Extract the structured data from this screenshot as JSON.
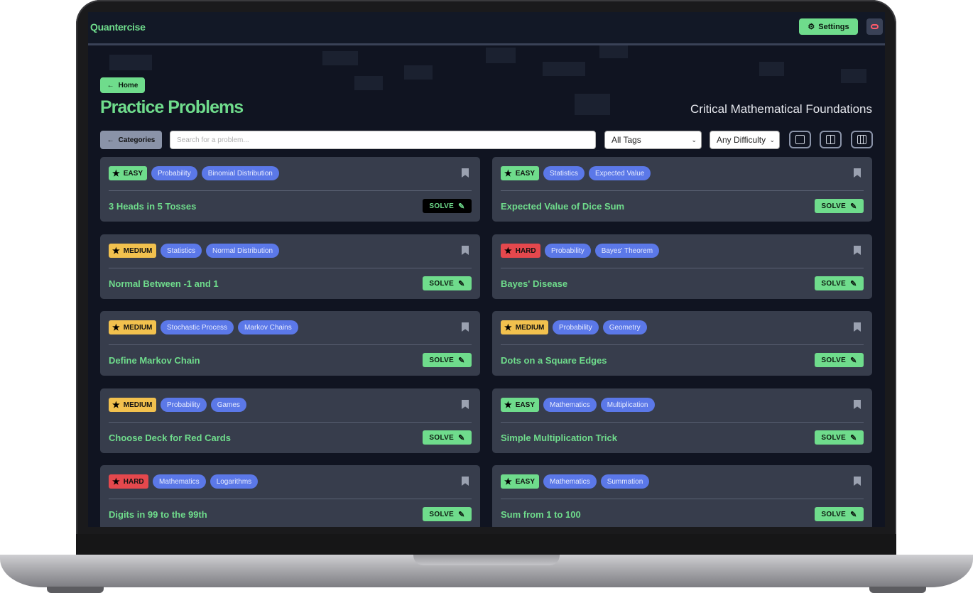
{
  "app": {
    "brand": "Quantercise"
  },
  "header": {
    "settings_label": "Settings",
    "settings_icon": "gear-icon",
    "toggle_icon": "toggle-icon"
  },
  "nav": {
    "home_label": "Home",
    "categories_label": "Categories"
  },
  "page": {
    "title": "Practice Problems",
    "subtitle": "Critical Mathematical Foundations"
  },
  "filters": {
    "search_placeholder": "Search for a problem...",
    "tags_selected": "All Tags",
    "difficulty_selected": "Any Difficulty"
  },
  "problems": [
    {
      "difficulty": "EASY",
      "tags": [
        "Probability",
        "Binomial Distribution"
      ],
      "title": "3 Heads in 5 Tosses",
      "solve": "SOLVE"
    },
    {
      "difficulty": "EASY",
      "tags": [
        "Statistics",
        "Expected Value"
      ],
      "title": "Expected Value of Dice Sum",
      "solve": "SOLVE"
    },
    {
      "difficulty": "MEDIUM",
      "tags": [
        "Statistics",
        "Normal Distribution"
      ],
      "title": "Normal Between -1 and 1",
      "solve": "SOLVE"
    },
    {
      "difficulty": "HARD",
      "tags": [
        "Probability",
        "Bayes' Theorem"
      ],
      "title": "Bayes' Disease",
      "solve": "SOLVE"
    },
    {
      "difficulty": "MEDIUM",
      "tags": [
        "Stochastic Process",
        "Markov Chains"
      ],
      "title": "Define Markov Chain",
      "solve": "SOLVE"
    },
    {
      "difficulty": "MEDIUM",
      "tags": [
        "Probability",
        "Geometry"
      ],
      "title": "Dots on a Square Edges",
      "solve": "SOLVE"
    },
    {
      "difficulty": "MEDIUM",
      "tags": [
        "Probability",
        "Games"
      ],
      "title": "Choose Deck for Red Cards",
      "solve": "SOLVE"
    },
    {
      "difficulty": "EASY",
      "tags": [
        "Mathematics",
        "Multiplication"
      ],
      "title": "Simple Multiplication Trick",
      "solve": "SOLVE"
    },
    {
      "difficulty": "HARD",
      "tags": [
        "Mathematics",
        "Logarithms"
      ],
      "title": "Digits in 99 to the 99th",
      "solve": "SOLVE"
    },
    {
      "difficulty": "EASY",
      "tags": [
        "Mathematics",
        "Summation"
      ],
      "title": "Sum from 1 to 100",
      "solve": "SOLVE"
    }
  ],
  "colors": {
    "accent": "#6fdc8c",
    "easy": "#6fdc8c",
    "medium": "#f2c14e",
    "hard": "#e5484d",
    "tag": "#5b78e8"
  }
}
